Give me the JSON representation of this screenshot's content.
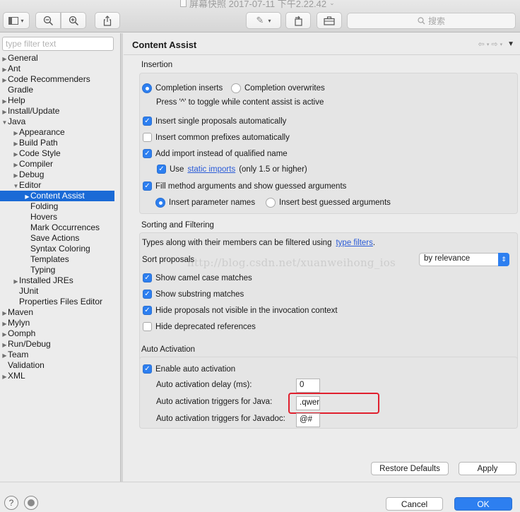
{
  "window": {
    "title": "屏幕快照 2017-07-11 下午2.22.42",
    "search_placeholder": "搜索"
  },
  "sidebar": {
    "filter_placeholder": "type filter text",
    "items": [
      {
        "label": "General",
        "level": 0,
        "twisty": "▶"
      },
      {
        "label": "Ant",
        "level": 0,
        "twisty": "▶"
      },
      {
        "label": "Code Recommenders",
        "level": 0,
        "twisty": "▶"
      },
      {
        "label": "Gradle",
        "level": 0,
        "twisty": ""
      },
      {
        "label": "Help",
        "level": 0,
        "twisty": "▶"
      },
      {
        "label": "Install/Update",
        "level": 0,
        "twisty": "▶"
      },
      {
        "label": "Java",
        "level": 0,
        "twisty": "▼"
      },
      {
        "label": "Appearance",
        "level": 1,
        "twisty": "▶"
      },
      {
        "label": "Build Path",
        "level": 1,
        "twisty": "▶"
      },
      {
        "label": "Code Style",
        "level": 1,
        "twisty": "▶"
      },
      {
        "label": "Compiler",
        "level": 1,
        "twisty": "▶"
      },
      {
        "label": "Debug",
        "level": 1,
        "twisty": "▶"
      },
      {
        "label": "Editor",
        "level": 1,
        "twisty": "▼"
      },
      {
        "label": "Content Assist",
        "level": 2,
        "twisty": "▶",
        "selected": true
      },
      {
        "label": "Folding",
        "level": 2,
        "twisty": ""
      },
      {
        "label": "Hovers",
        "level": 2,
        "twisty": ""
      },
      {
        "label": "Mark Occurrences",
        "level": 2,
        "twisty": ""
      },
      {
        "label": "Save Actions",
        "level": 2,
        "twisty": ""
      },
      {
        "label": "Syntax Coloring",
        "level": 2,
        "twisty": ""
      },
      {
        "label": "Templates",
        "level": 2,
        "twisty": ""
      },
      {
        "label": "Typing",
        "level": 2,
        "twisty": ""
      },
      {
        "label": "Installed JREs",
        "level": 1,
        "twisty": "▶"
      },
      {
        "label": "JUnit",
        "level": 1,
        "twisty": ""
      },
      {
        "label": "Properties Files Editor",
        "level": 1,
        "twisty": ""
      },
      {
        "label": "Maven",
        "level": 0,
        "twisty": "▶"
      },
      {
        "label": "Mylyn",
        "level": 0,
        "twisty": "▶"
      },
      {
        "label": "Oomph",
        "level": 0,
        "twisty": "▶"
      },
      {
        "label": "Run/Debug",
        "level": 0,
        "twisty": "▶"
      },
      {
        "label": "Team",
        "level": 0,
        "twisty": "▶"
      },
      {
        "label": "Validation",
        "level": 0,
        "twisty": ""
      },
      {
        "label": "XML",
        "level": 0,
        "twisty": "▶"
      }
    ]
  },
  "main": {
    "title": "Content Assist",
    "insertion": {
      "heading": "Insertion",
      "completion_inserts": "Completion inserts",
      "completion_overwrites": "Completion overwrites",
      "toggle_hint": "Press '^' to toggle while content assist is active",
      "single_proposals": "Insert single proposals automatically",
      "common_prefixes": "Insert common prefixes automatically",
      "add_import": "Add import instead of qualified name",
      "use_prefix": "Use",
      "static_imports_link": "static imports",
      "static_imports_suffix": "(only 1.5 or higher)",
      "fill_method_args": "Fill method arguments and show guessed arguments",
      "insert_param_names": "Insert parameter names",
      "insert_best_guessed": "Insert best guessed arguments"
    },
    "sorting": {
      "heading": "Sorting and Filtering",
      "types_filtered_prefix": "Types along with their members can be filtered using",
      "type_filters_link": "type filters",
      "types_filtered_suffix": ".",
      "sort_proposals_label": "Sort proposals",
      "sort_value": "by relevance",
      "camel_case": "Show camel case matches",
      "substring": "Show substring matches",
      "hide_not_visible": "Hide proposals not visible in the invocation context",
      "hide_deprecated": "Hide deprecated references"
    },
    "auto_activation": {
      "heading": "Auto Activation",
      "enable": "Enable auto activation",
      "delay_label": "Auto activation delay (ms):",
      "delay_value": "0",
      "java_triggers_label": "Auto activation triggers for Java:",
      "java_triggers_value": ".qwer",
      "javadoc_triggers_label": "Auto activation triggers for Javadoc:",
      "javadoc_triggers_value": "@#"
    },
    "watermark": "http://blog.csdn.net/xuanweihong_ios",
    "restore_defaults": "Restore Defaults",
    "apply": "Apply"
  },
  "footer": {
    "cancel": "Cancel",
    "ok": "OK"
  },
  "colors": {
    "accent": "#2d7ff0",
    "selection": "#1a6ad6",
    "highlight_box": "#e0202e",
    "link": "#2a5bd7"
  }
}
